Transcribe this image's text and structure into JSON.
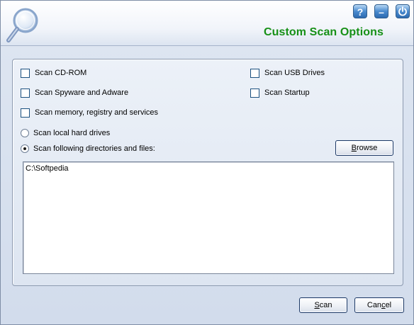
{
  "window": {
    "title": "Custom Scan Options",
    "buttons": {
      "help": "?",
      "minimize": "–",
      "power": "⏻"
    }
  },
  "options": {
    "scan_cdrom": {
      "label": "Scan CD-ROM",
      "checked": false
    },
    "scan_usb": {
      "label": "Scan USB Drives",
      "checked": false
    },
    "scan_spyware": {
      "label": "Scan Spyware and Adware",
      "checked": false
    },
    "scan_startup": {
      "label": "Scan Startup",
      "checked": false
    },
    "scan_memory": {
      "label": "Scan memory, registry and services",
      "checked": false
    },
    "scan_local": {
      "label": "Scan local hard drives",
      "selected": false
    },
    "scan_following": {
      "label": "Scan following directories and files:",
      "selected": true
    }
  },
  "browse_button": {
    "label": "Browse",
    "accel": "B",
    "rest": "rowse"
  },
  "paths": [
    "C:\\Softpedia"
  ],
  "footer": {
    "scan": {
      "label": "Scan",
      "accel": "S",
      "rest": "can"
    },
    "cancel": {
      "label": "Cancel",
      "pre": "Can",
      "accel": "c",
      "rest": "el"
    }
  },
  "colors": {
    "title": "#169016",
    "button_blue": "#2d6bb0"
  }
}
